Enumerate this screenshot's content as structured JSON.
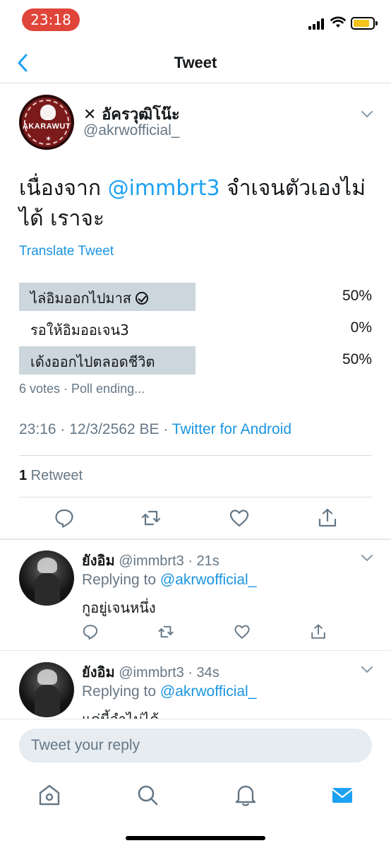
{
  "status_bar": {
    "time": "23:18"
  },
  "nav": {
    "title": "Tweet"
  },
  "tweet": {
    "author_name": "✕ อัครวุฒิโน๊ะ",
    "author_handle": "@akrwofficial_",
    "avatar_brand": "AKARAWUT",
    "text_before": "เนื่องจาก ",
    "text_mention": "@immbrt3",
    "text_after": " จำเจนตัวเองไม่ได้ เราจะ",
    "translate": "Translate Tweet",
    "poll": {
      "options": [
        {
          "label": "ไล่อิมออกไปมาส",
          "percent_text": "50%",
          "percent": 50,
          "winner": true
        },
        {
          "label": "รอให้อิมออเจน3",
          "percent_text": "0%",
          "percent": 0,
          "winner": false
        },
        {
          "label": "เด้งออกไปตลอดชีวิต",
          "percent_text": "50%",
          "percent": 50,
          "winner": true
        }
      ],
      "meta": "6 votes · Poll ending..."
    },
    "timestamp": "23:16 · 12/3/2562 BE · ",
    "source": "Twitter for Android",
    "retweet_count": "1",
    "retweet_label": " Retweet"
  },
  "replies": [
    {
      "name": "ยังอิม",
      "handle": " @immbrt3 · 21s",
      "replying_to": "Replying to ",
      "replying_mention": "@akrwofficial_",
      "text": "กูอยู่เจนหนึ่ง"
    },
    {
      "name": "ยังอิม",
      "handle": " @immbrt3 · 34s",
      "replying_to": "Replying to ",
      "replying_mention": "@akrwofficial_",
      "text": "แค่นี้จำไม่ได้"
    }
  ],
  "reply_box": {
    "placeholder": "Tweet your reply"
  },
  "icons": {
    "back": "chevron-left-icon",
    "more": "chevron-down-icon",
    "reply": "comment-icon",
    "retweet": "retweet-icon",
    "like": "heart-icon",
    "share": "share-icon",
    "home": "home-icon",
    "search": "search-icon",
    "notifications": "bell-icon",
    "messages": "mail-icon"
  },
  "colors": {
    "accent": "#1da1f2",
    "time_pill": "#e0453a",
    "poll_bar": "#ccd6dd",
    "muted": "#657786"
  }
}
